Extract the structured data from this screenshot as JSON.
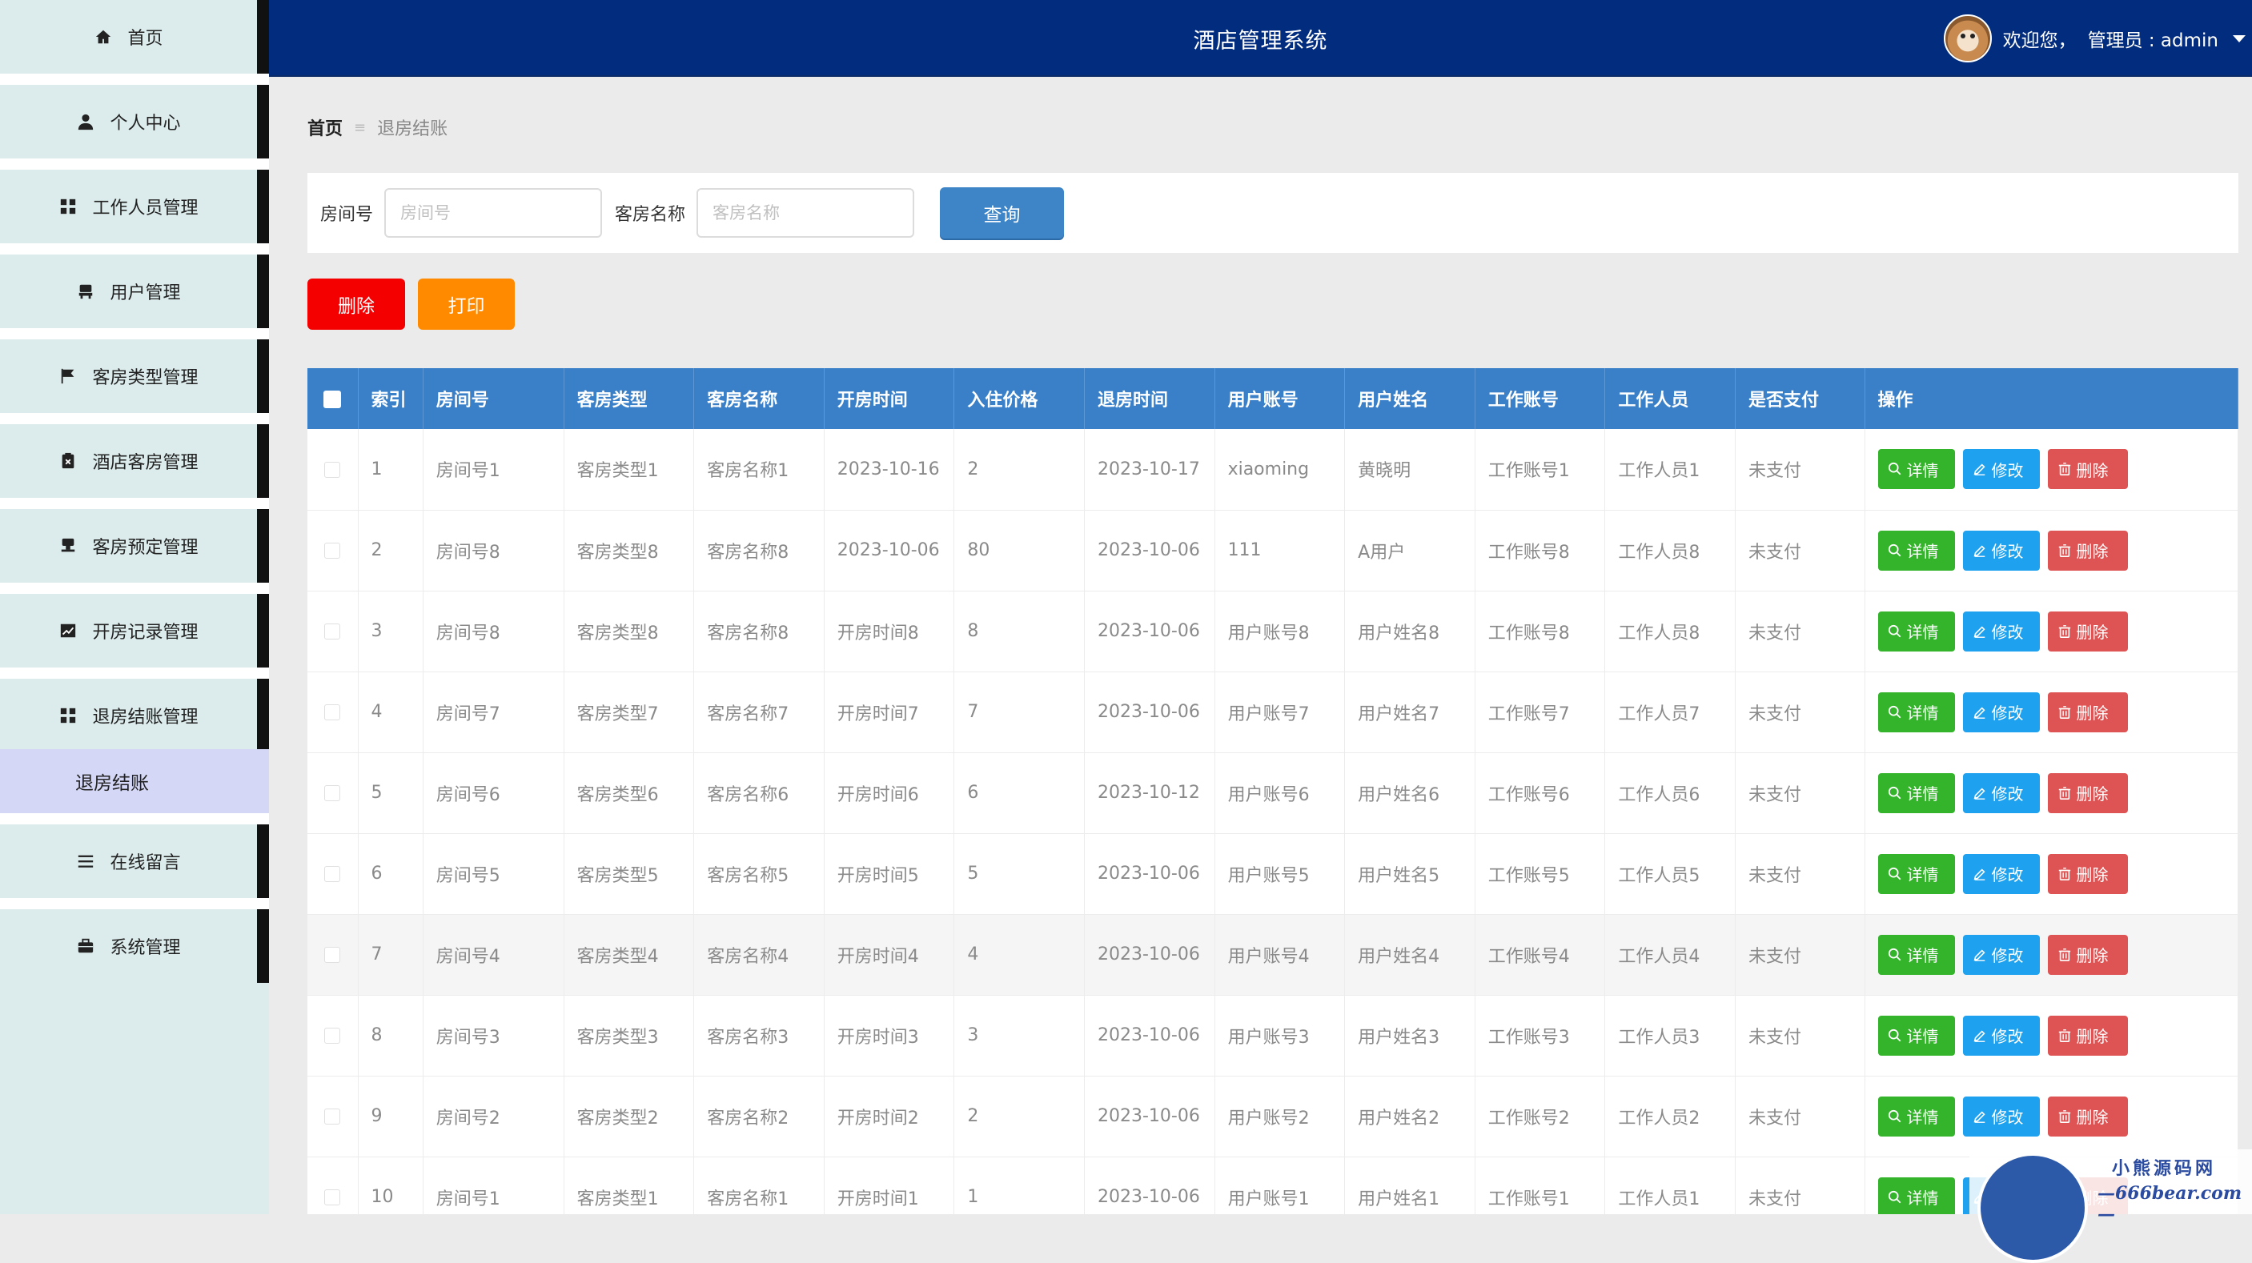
{
  "header": {
    "title": "酒店管理系统",
    "welcome": "欢迎您，",
    "user_label": "管理员 : admin"
  },
  "sidebar": {
    "items": [
      {
        "label": "首页",
        "icon": "home-icon"
      },
      {
        "label": "个人中心",
        "icon": "user-icon"
      },
      {
        "label": "工作人员管理",
        "icon": "grid-icon"
      },
      {
        "label": "用户管理",
        "icon": "chair-icon"
      },
      {
        "label": "客房类型管理",
        "icon": "flag-icon"
      },
      {
        "label": "酒店客房管理",
        "icon": "clipboard-x-icon"
      },
      {
        "label": "客房预定管理",
        "icon": "stamp-icon"
      },
      {
        "label": "开房记录管理",
        "icon": "chart-icon"
      },
      {
        "label": "退房结账管理",
        "icon": "grid-icon"
      },
      {
        "label": "在线留言",
        "icon": "list-icon"
      },
      {
        "label": "系统管理",
        "icon": "briefcase-icon"
      }
    ],
    "active_sub": "退房结账"
  },
  "breadcrumb": {
    "home": "首页",
    "separator": "≡",
    "current": "退房结账"
  },
  "search": {
    "room_no_label": "房间号",
    "room_no_placeholder": "房间号",
    "room_no_value": "",
    "room_name_label": "客房名称",
    "room_name_placeholder": "客房名称",
    "room_name_value": "",
    "query_label": "查询"
  },
  "actions": {
    "delete_label": "删除",
    "print_label": "打印"
  },
  "table": {
    "columns": [
      "索引",
      "房间号",
      "客房类型",
      "客房名称",
      "开房时间",
      "入住价格",
      "退房时间",
      "用户账号",
      "用户姓名",
      "工作账号",
      "工作人员",
      "是否支付",
      "操作"
    ],
    "rows": [
      [
        "1",
        "房间号1",
        "客房类型1",
        "客房名称1",
        "2023-10-16",
        "2",
        "2023-10-17",
        "xiaoming",
        "黄晓明",
        "工作账号1",
        "工作人员1",
        "未支付"
      ],
      [
        "2",
        "房间号8",
        "客房类型8",
        "客房名称8",
        "2023-10-06",
        "80",
        "2023-10-06",
        "111",
        "A用户",
        "工作账号8",
        "工作人员8",
        "未支付"
      ],
      [
        "3",
        "房间号8",
        "客房类型8",
        "客房名称8",
        "开房时间8",
        "8",
        "2023-10-06",
        "用户账号8",
        "用户姓名8",
        "工作账号8",
        "工作人员8",
        "未支付"
      ],
      [
        "4",
        "房间号7",
        "客房类型7",
        "客房名称7",
        "开房时间7",
        "7",
        "2023-10-06",
        "用户账号7",
        "用户姓名7",
        "工作账号7",
        "工作人员7",
        "未支付"
      ],
      [
        "5",
        "房间号6",
        "客房类型6",
        "客房名称6",
        "开房时间6",
        "6",
        "2023-10-12",
        "用户账号6",
        "用户姓名6",
        "工作账号6",
        "工作人员6",
        "未支付"
      ],
      [
        "6",
        "房间号5",
        "客房类型5",
        "客房名称5",
        "开房时间5",
        "5",
        "2023-10-06",
        "用户账号5",
        "用户姓名5",
        "工作账号5",
        "工作人员5",
        "未支付"
      ],
      [
        "7",
        "房间号4",
        "客房类型4",
        "客房名称4",
        "开房时间4",
        "4",
        "2023-10-06",
        "用户账号4",
        "用户姓名4",
        "工作账号4",
        "工作人员4",
        "未支付"
      ],
      [
        "8",
        "房间号3",
        "客房类型3",
        "客房名称3",
        "开房时间3",
        "3",
        "2023-10-06",
        "用户账号3",
        "用户姓名3",
        "工作账号3",
        "工作人员3",
        "未支付"
      ],
      [
        "9",
        "房间号2",
        "客房类型2",
        "客房名称2",
        "开房时间2",
        "2",
        "2023-10-06",
        "用户账号2",
        "用户姓名2",
        "工作账号2",
        "工作人员2",
        "未支付"
      ],
      [
        "10",
        "房间号1",
        "客房类型1",
        "客房名称1",
        "开房时间1",
        "1",
        "2023-10-06",
        "用户账号1",
        "用户姓名1",
        "工作账号1",
        "工作人员1",
        "未支付"
      ]
    ],
    "row_actions": {
      "view": "详情",
      "edit": "修改",
      "delete": "删除"
    },
    "highlighted_row": 7
  },
  "watermark": {
    "line1": "小熊源码网",
    "line2": "—666bear.com—"
  },
  "colors": {
    "header_bg": "#022c7e",
    "sidebar_bg": "#dcebeb",
    "table_header_bg": "#3a80c9",
    "query_button": "#3e85c8",
    "delete_button": "#f50000",
    "print_button": "#ff8a00",
    "view_button": "#33b42a",
    "edit_button": "#1ea1ee",
    "row_delete_button": "#de5454"
  }
}
